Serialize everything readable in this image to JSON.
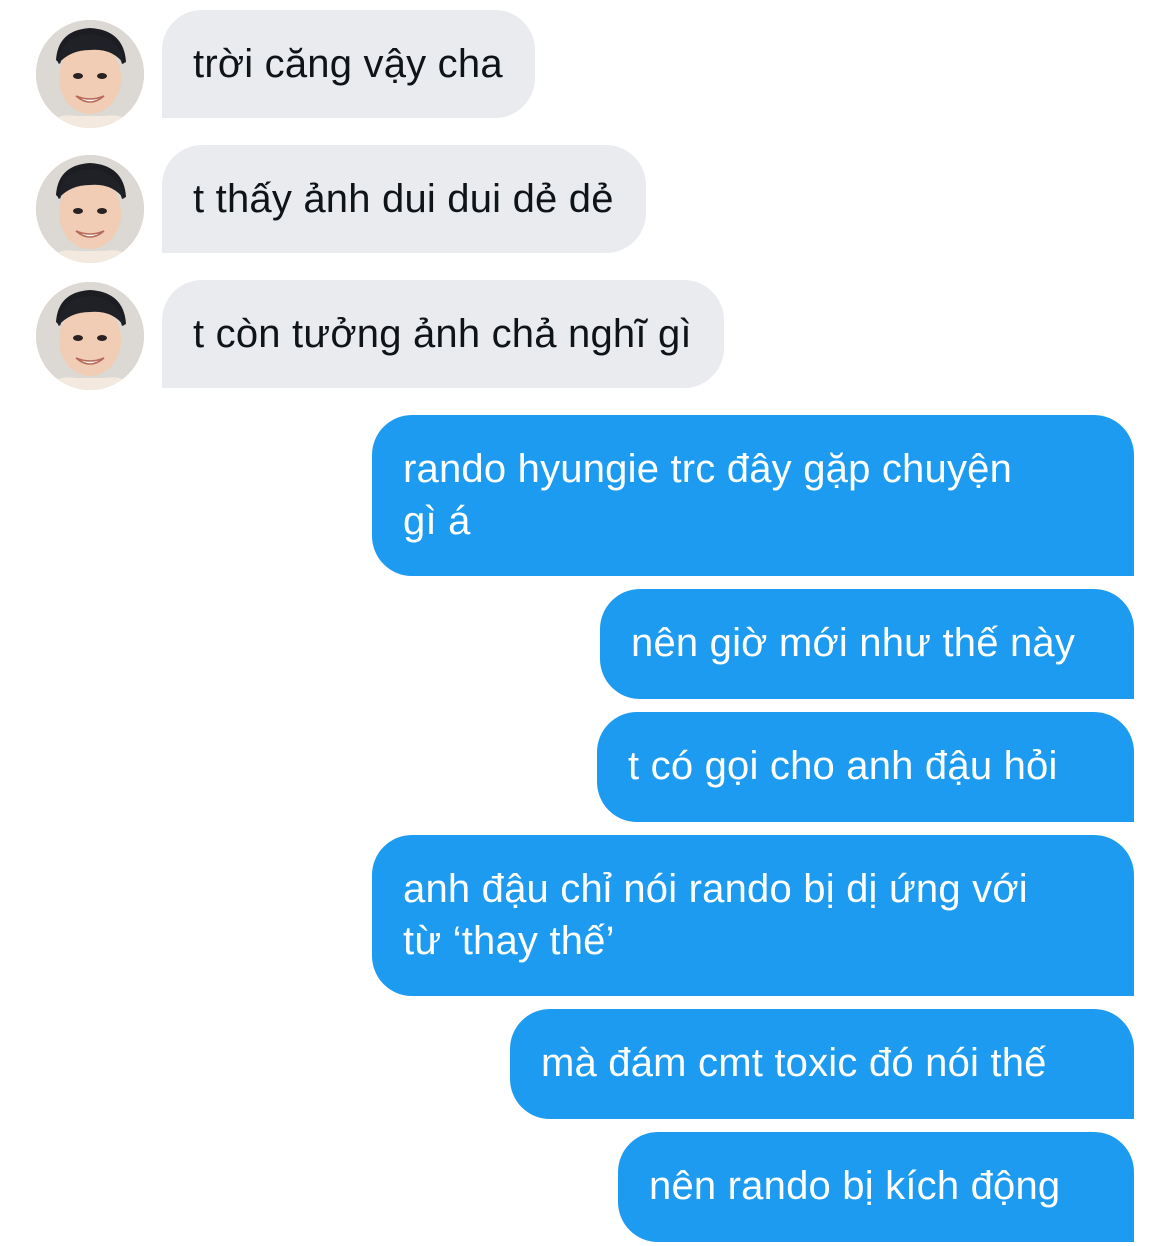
{
  "conversation": {
    "incoming": [
      {
        "text": "trời căng vậy cha",
        "avatar_icon": "contact-avatar-photo"
      },
      {
        "text": "t thấy ảnh dui dui dẻ dẻ",
        "avatar_icon": "contact-avatar-photo"
      },
      {
        "text": "t còn tưởng ảnh chả nghĩ gì",
        "avatar_icon": "contact-avatar-photo"
      }
    ],
    "outgoing": [
      {
        "text": "rando hyungie trc đây gặp chuyện\ngì á"
      },
      {
        "text": "nên giờ mới như thế này"
      },
      {
        "text": "t có gọi cho anh đậu hỏi"
      },
      {
        "text": "anh đậu chỉ nói rando bị dị ứng với\ntừ ‘thay thế’"
      },
      {
        "text": "mà đám cmt toxic đó nói thế"
      },
      {
        "text": "nên rando bị kích động"
      }
    ]
  },
  "colors": {
    "incoming_bubble": "#e9ebee",
    "incoming_text": "#0f1419",
    "outgoing_bubble": "#1d9bf0",
    "outgoing_text": "#ffffff"
  }
}
